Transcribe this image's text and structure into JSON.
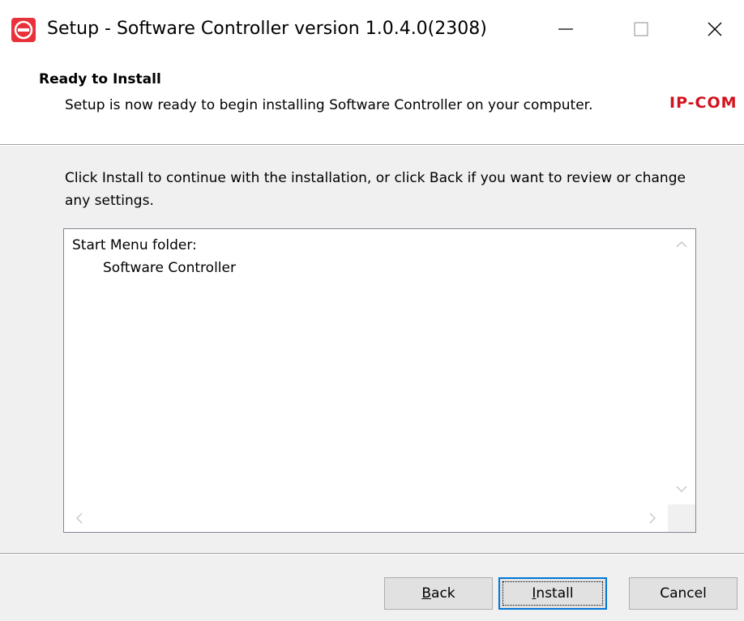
{
  "window": {
    "title": "Setup - Software Controller version 1.0.4.0(2308)",
    "icon": "app-logo-icon",
    "controls": [
      "minimize-icon",
      "maximize-icon",
      "close-icon"
    ]
  },
  "header": {
    "title": "Ready to Install",
    "subtitle": "Setup is now ready to begin installing Software Controller on your computer.",
    "brand": "IP-COM",
    "brand_color": "#d3121f"
  },
  "body": {
    "instructions": "Click Install to continue with the installation, or click Back if you want to review or change any settings.",
    "memo": {
      "line1": "Start Menu folder:",
      "line2": "Software Controller"
    }
  },
  "buttons": {
    "back_accel": "B",
    "back_rest": "ack",
    "install_accel": "I",
    "install_rest": "nstall",
    "cancel": "Cancel"
  },
  "colors": {
    "accent": "#0078d7",
    "dialog_bg": "#f0f0f0"
  }
}
